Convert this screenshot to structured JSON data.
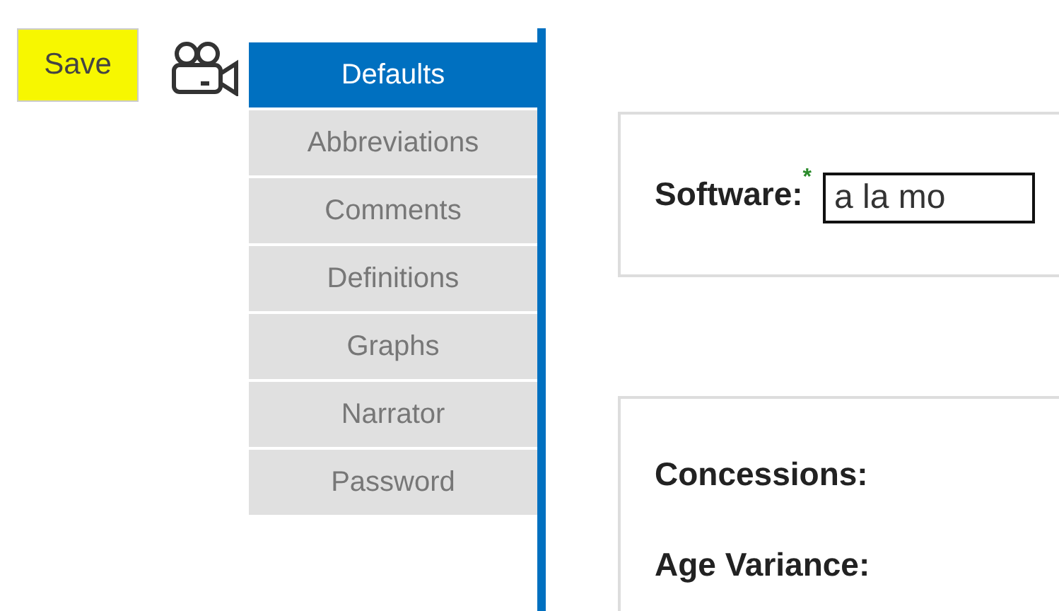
{
  "toolbar": {
    "save_button": "Save"
  },
  "tabs": [
    {
      "label": "Defaults",
      "selected": true
    },
    {
      "label": "Abbreviations",
      "selected": false
    },
    {
      "label": "Comments",
      "selected": false
    },
    {
      "label": "Definitions",
      "selected": false
    },
    {
      "label": "Graphs",
      "selected": false
    },
    {
      "label": "Narrator",
      "selected": false
    },
    {
      "label": "Password",
      "selected": false
    }
  ],
  "software": {
    "label": "Software:",
    "required_mark": "*",
    "value": "a la mo"
  },
  "fields": [
    {
      "label": "Concessions:"
    },
    {
      "label": "Age Variance:"
    }
  ]
}
